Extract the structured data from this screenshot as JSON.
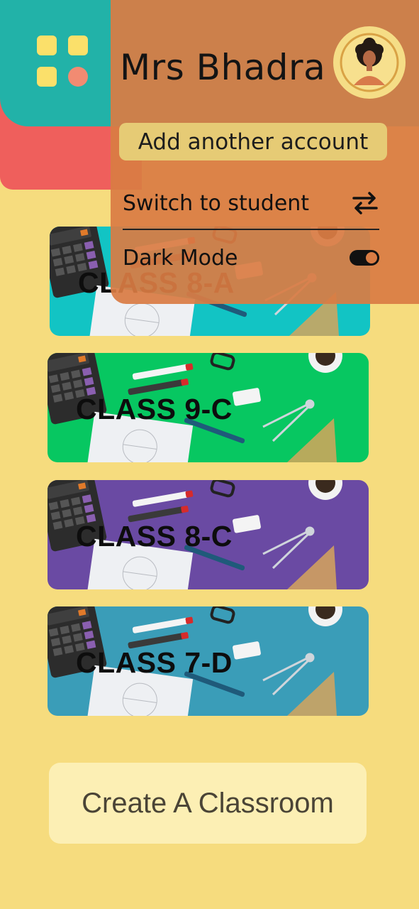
{
  "header": {
    "apps_icon": "apps-grid-icon",
    "colors": {
      "teal": "#22b2a8",
      "red": "#ef5f5c",
      "background": "#f6dc7e"
    }
  },
  "account_menu": {
    "name": "Mrs Bhadra",
    "avatar_icon": "user-avatar",
    "add_account_label": "Add another account",
    "switch_label": "Switch to student",
    "switch_icon": "swap-arrows-icon",
    "dark_mode_label": "Dark Mode",
    "dark_mode_on": true,
    "color": "#d97c44"
  },
  "classes": [
    {
      "name": "CLASS 8-A",
      "color": "#12c4c4"
    },
    {
      "name": "CLASS 9-C",
      "color": "#07c761"
    },
    {
      "name": "CLASS 8-C",
      "color": "#6a4aa3"
    },
    {
      "name": "CLASS 7-D",
      "color": "#3a9db8"
    }
  ],
  "create_button_label": "Create A Classroom"
}
